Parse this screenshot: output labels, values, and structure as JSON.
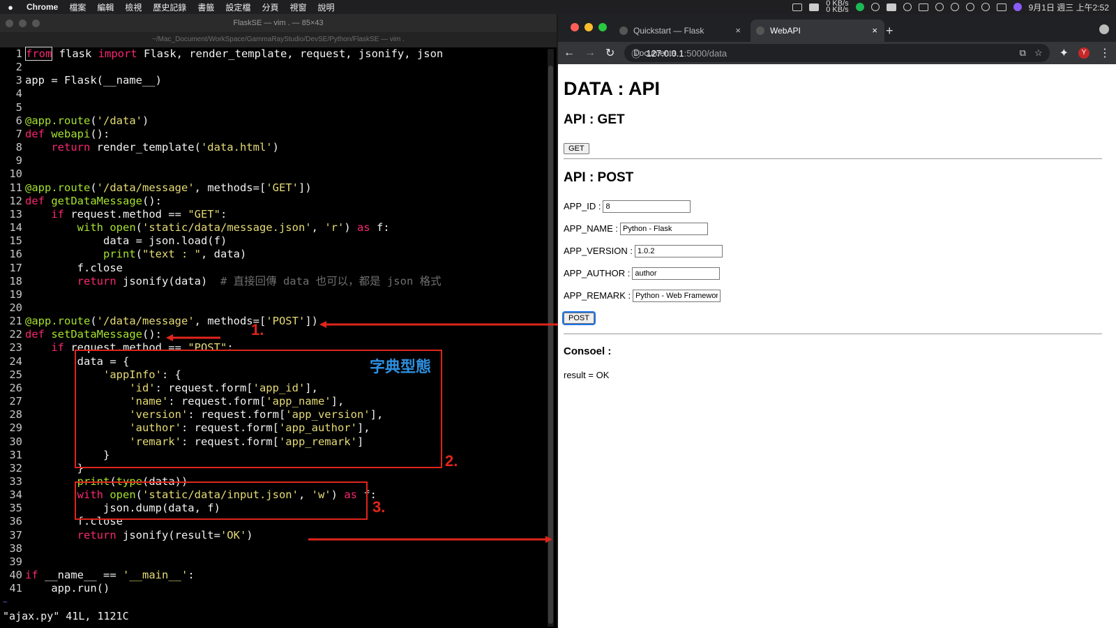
{
  "menubar": {
    "apple": "",
    "items": [
      "Chrome",
      "檔案",
      "編輯",
      "檢視",
      "歷史記錄",
      "書籤",
      "設定檔",
      "分頁",
      "視窗",
      "說明"
    ],
    "net_up": "0 KB/s",
    "net_down": "0 KB/s",
    "clock": "9月1日 週三 上午2:52"
  },
  "vim": {
    "title": "FlaskSE — vim . — 85×43",
    "path": "~/Mac_Document/WorkSpace/GammaRayStudio/DevSE/Python/FlaskSE — vim .",
    "status": "\"ajax.py\" 41L, 1121C",
    "tilde": "~",
    "lines": [
      {
        "n": "1",
        "t": [
          [
            "kw",
            "from"
          ],
          [
            "",
            " flask "
          ],
          [
            "kw",
            "import"
          ],
          [
            "",
            " Flask, render_template, request, jsonify, json"
          ]
        ]
      },
      {
        "n": "2",
        "t": []
      },
      {
        "n": "3",
        "t": [
          [
            "",
            "app = Flask(__name__)"
          ]
        ]
      },
      {
        "n": "4",
        "t": []
      },
      {
        "n": "5",
        "t": []
      },
      {
        "n": "6",
        "t": [
          [
            "dec",
            "@app.route"
          ],
          [
            "",
            "("
          ],
          [
            "str",
            "'/data'"
          ],
          [
            "",
            ")"
          ]
        ]
      },
      {
        "n": "7",
        "t": [
          [
            "kw",
            "def"
          ],
          [
            "",
            " "
          ],
          [
            "fn",
            "webapi"
          ],
          [
            "",
            "():"
          ]
        ]
      },
      {
        "n": "8",
        "t": [
          [
            "",
            "    "
          ],
          [
            "kw",
            "return"
          ],
          [
            "",
            " render_template("
          ],
          [
            "str",
            "'data.html'"
          ],
          [
            "",
            ")"
          ]
        ]
      },
      {
        "n": "9",
        "t": []
      },
      {
        "n": "10",
        "t": []
      },
      {
        "n": "11",
        "t": [
          [
            "dec",
            "@app.route"
          ],
          [
            "",
            "("
          ],
          [
            "str",
            "'/data/message'"
          ],
          [
            "",
            ", methods=["
          ],
          [
            "str",
            "'GET'"
          ],
          [
            "",
            "])"
          ]
        ]
      },
      {
        "n": "12",
        "t": [
          [
            "kw",
            "def"
          ],
          [
            "",
            " "
          ],
          [
            "fn",
            "getDataMessage"
          ],
          [
            "",
            "():"
          ]
        ]
      },
      {
        "n": "13",
        "t": [
          [
            "",
            "    "
          ],
          [
            "kw",
            "if"
          ],
          [
            "",
            " request.method == "
          ],
          [
            "str",
            "\"GET\""
          ],
          [
            "",
            ":"
          ]
        ]
      },
      {
        "n": "14",
        "t": [
          [
            "",
            "        "
          ],
          [
            "fn",
            "with"
          ],
          [
            "",
            " "
          ],
          [
            "fn",
            "open"
          ],
          [
            "",
            "("
          ],
          [
            "str",
            "'static/data/message.json'"
          ],
          [
            "",
            ", "
          ],
          [
            "str",
            "'r'"
          ],
          [
            "",
            ") "
          ],
          [
            "kw",
            "as"
          ],
          [
            "",
            " f:"
          ]
        ]
      },
      {
        "n": "15",
        "t": [
          [
            "",
            "            data = json.load(f)"
          ]
        ]
      },
      {
        "n": "16",
        "t": [
          [
            "",
            "            "
          ],
          [
            "fn",
            "print"
          ],
          [
            "",
            "("
          ],
          [
            "str",
            "\"text : \""
          ],
          [
            "",
            ", data)"
          ]
        ]
      },
      {
        "n": "17",
        "t": [
          [
            "",
            "        f.close"
          ]
        ]
      },
      {
        "n": "18",
        "t": [
          [
            "",
            "        "
          ],
          [
            "kw",
            "return"
          ],
          [
            "",
            " jsonify(data)  "
          ],
          [
            "cm",
            "# 直接回傳 data 也可以，都是 json 格式"
          ]
        ]
      },
      {
        "n": "19",
        "t": []
      },
      {
        "n": "20",
        "t": []
      },
      {
        "n": "21",
        "t": [
          [
            "dec",
            "@app.route"
          ],
          [
            "",
            "("
          ],
          [
            "str",
            "'/data/message'"
          ],
          [
            "",
            ", methods=["
          ],
          [
            "str",
            "'POST'"
          ],
          [
            "",
            "])"
          ]
        ]
      },
      {
        "n": "22",
        "t": [
          [
            "kw",
            "def"
          ],
          [
            "",
            " "
          ],
          [
            "fn",
            "setDataMessage"
          ],
          [
            "",
            "():"
          ]
        ]
      },
      {
        "n": "23",
        "t": [
          [
            "",
            "    "
          ],
          [
            "kw",
            "if"
          ],
          [
            "",
            " request.method == "
          ],
          [
            "str",
            "\"POST\""
          ],
          [
            "",
            ":"
          ]
        ]
      },
      {
        "n": "24",
        "t": [
          [
            "",
            "        data = {"
          ]
        ]
      },
      {
        "n": "25",
        "t": [
          [
            "",
            "            "
          ],
          [
            "str",
            "'appInfo'"
          ],
          [
            "",
            ": {"
          ]
        ]
      },
      {
        "n": "26",
        "t": [
          [
            "",
            "                "
          ],
          [
            "str",
            "'id'"
          ],
          [
            "",
            ": request.form["
          ],
          [
            "str",
            "'app_id'"
          ],
          [
            "",
            "],"
          ]
        ]
      },
      {
        "n": "27",
        "t": [
          [
            "",
            "                "
          ],
          [
            "str",
            "'name'"
          ],
          [
            "",
            ": request.form["
          ],
          [
            "str",
            "'app_name'"
          ],
          [
            "",
            "],"
          ]
        ]
      },
      {
        "n": "28",
        "t": [
          [
            "",
            "                "
          ],
          [
            "str",
            "'version'"
          ],
          [
            "",
            ": request.form["
          ],
          [
            "str",
            "'app_version'"
          ],
          [
            "",
            "],"
          ]
        ]
      },
      {
        "n": "29",
        "t": [
          [
            "",
            "                "
          ],
          [
            "str",
            "'author'"
          ],
          [
            "",
            ": request.form["
          ],
          [
            "str",
            "'app_author'"
          ],
          [
            "",
            "],"
          ]
        ]
      },
      {
        "n": "30",
        "t": [
          [
            "",
            "                "
          ],
          [
            "str",
            "'remark'"
          ],
          [
            "",
            ": request.form["
          ],
          [
            "str",
            "'app_remark'"
          ],
          [
            "",
            "]"
          ]
        ]
      },
      {
        "n": "31",
        "t": [
          [
            "",
            "            }"
          ]
        ]
      },
      {
        "n": "32",
        "t": [
          [
            "",
            "        }"
          ]
        ]
      },
      {
        "n": "33",
        "t": [
          [
            "",
            "        "
          ],
          [
            "fn",
            "print"
          ],
          [
            "",
            "("
          ],
          [
            "fn",
            "type"
          ],
          [
            "",
            "(data))"
          ]
        ]
      },
      {
        "n": "34",
        "t": [
          [
            "",
            "        "
          ],
          [
            "kw",
            "with"
          ],
          [
            "",
            " "
          ],
          [
            "fn",
            "open"
          ],
          [
            "",
            "("
          ],
          [
            "str",
            "'static/data/input.json'"
          ],
          [
            "",
            ", "
          ],
          [
            "str",
            "'w'"
          ],
          [
            "",
            ") "
          ],
          [
            "kw",
            "as"
          ],
          [
            "",
            " f:"
          ]
        ]
      },
      {
        "n": "35",
        "t": [
          [
            "",
            "            json.dump(data, f)"
          ]
        ]
      },
      {
        "n": "36",
        "t": [
          [
            "",
            "        f.close"
          ]
        ]
      },
      {
        "n": "37",
        "t": [
          [
            "",
            "        "
          ],
          [
            "kw",
            "return"
          ],
          [
            "",
            " jsonify(result="
          ],
          [
            "str",
            "'OK'"
          ],
          [
            "",
            ")"
          ]
        ]
      },
      {
        "n": "38",
        "t": []
      },
      {
        "n": "39",
        "t": []
      },
      {
        "n": "40",
        "t": [
          [
            "kw",
            "if"
          ],
          [
            "",
            " __name__ == "
          ],
          [
            "str",
            "'__main__'"
          ],
          [
            "",
            ":"
          ]
        ]
      },
      {
        "n": "41",
        "t": [
          [
            "",
            "    app.run()"
          ]
        ]
      }
    ]
  },
  "annotations": {
    "num1": "1.",
    "num2": "2.",
    "num3": "3.",
    "dict_label": "字典型態",
    "accent_color": "#e0251b",
    "label_color": "#2c8fe0"
  },
  "chrome": {
    "tab1": "Quickstart — Flask Documenta",
    "tab2": "WebAPI",
    "tab_close": "×",
    "new_tab": "+",
    "url_host": "127.0.0.1",
    "url_path": ":5000/data"
  },
  "page": {
    "h1": "DATA : API",
    "get_heading": "API : GET",
    "get_button": "GET",
    "post_heading": "API : POST",
    "fields": [
      {
        "label": "APP_ID :",
        "value": "8"
      },
      {
        "label": "APP_NAME :",
        "value": "Python - Flask"
      },
      {
        "label": "APP_VERSION :",
        "value": "1.0.2"
      },
      {
        "label": "APP_AUTHOR :",
        "value": "author"
      },
      {
        "label": "APP_REMARK :",
        "value": "Python - Web Framework"
      }
    ],
    "post_button": "POST",
    "console_heading": "Consoel :",
    "result": "result = OK"
  }
}
